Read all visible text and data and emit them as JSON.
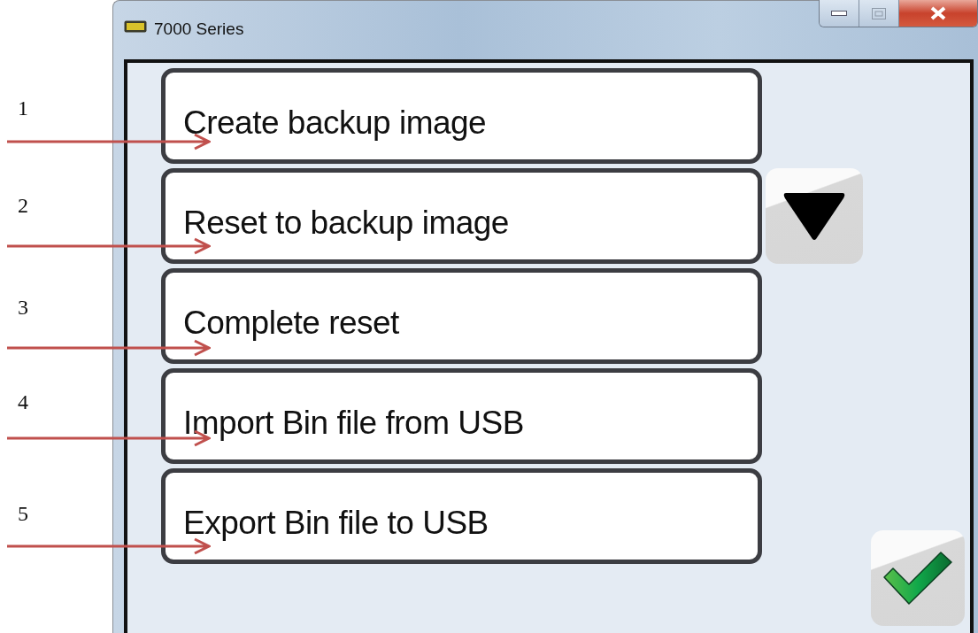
{
  "window": {
    "title": "7000 Series"
  },
  "menu_items": [
    {
      "label": "Create backup image",
      "callout": "1"
    },
    {
      "label": "Reset to backup image",
      "callout": "2"
    },
    {
      "label": "Complete reset",
      "callout": "3"
    },
    {
      "label": "Import Bin file from USB",
      "callout": "4"
    },
    {
      "label": "Export Bin file to USB",
      "callout": "5"
    }
  ]
}
